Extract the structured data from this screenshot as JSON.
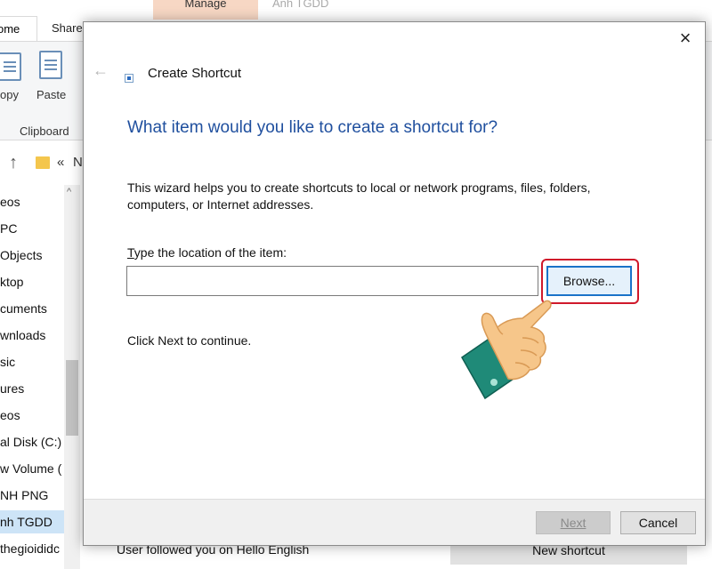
{
  "explorer": {
    "tabs": {
      "home": "ome",
      "share": "Share",
      "manage": "Manage",
      "context": "Anh TGDD"
    },
    "ribbon": {
      "copy_label": "opy",
      "paste_label": "Paste",
      "group_label": "Clipboard"
    },
    "nav": {
      "chevron": "«",
      "path_fragment": "N"
    },
    "sidebar": [
      {
        "label": "eos"
      },
      {
        "label": "PC"
      },
      {
        "label": "Objects"
      },
      {
        "label": "ktop"
      },
      {
        "label": "cuments"
      },
      {
        "label": "wnloads"
      },
      {
        "label": "sic"
      },
      {
        "label": "ures"
      },
      {
        "label": "eos"
      },
      {
        "label": "al Disk (C:)"
      },
      {
        "label": "w Volume ("
      },
      {
        "label": "NH PNG"
      },
      {
        "label": "nh TGDD"
      },
      {
        "label": "thegioididc"
      }
    ],
    "status_text": "User followed you on Hello English",
    "new_shortcut_label": "New shortcut"
  },
  "dialog": {
    "close_icon": "×",
    "back_icon": "←",
    "title": "Create Shortcut",
    "heading": "What item would you like to create a shortcut for?",
    "description": "This wizard helps you to create shortcuts to local or network programs, files, folders, computers, or Internet addresses.",
    "field_label_accel": "T",
    "field_label_rest": "ype the location of the item:",
    "location_value": "",
    "browse_label": "Browse...",
    "continue_text": "Click Next to continue.",
    "next_label": "Next",
    "cancel_label": "Cancel"
  },
  "colors": {
    "heading_blue": "#1f4f9e",
    "highlight_red": "#d0192b",
    "hand_skin": "#f6c68a",
    "sleeve_teal": "#1f8a78"
  }
}
